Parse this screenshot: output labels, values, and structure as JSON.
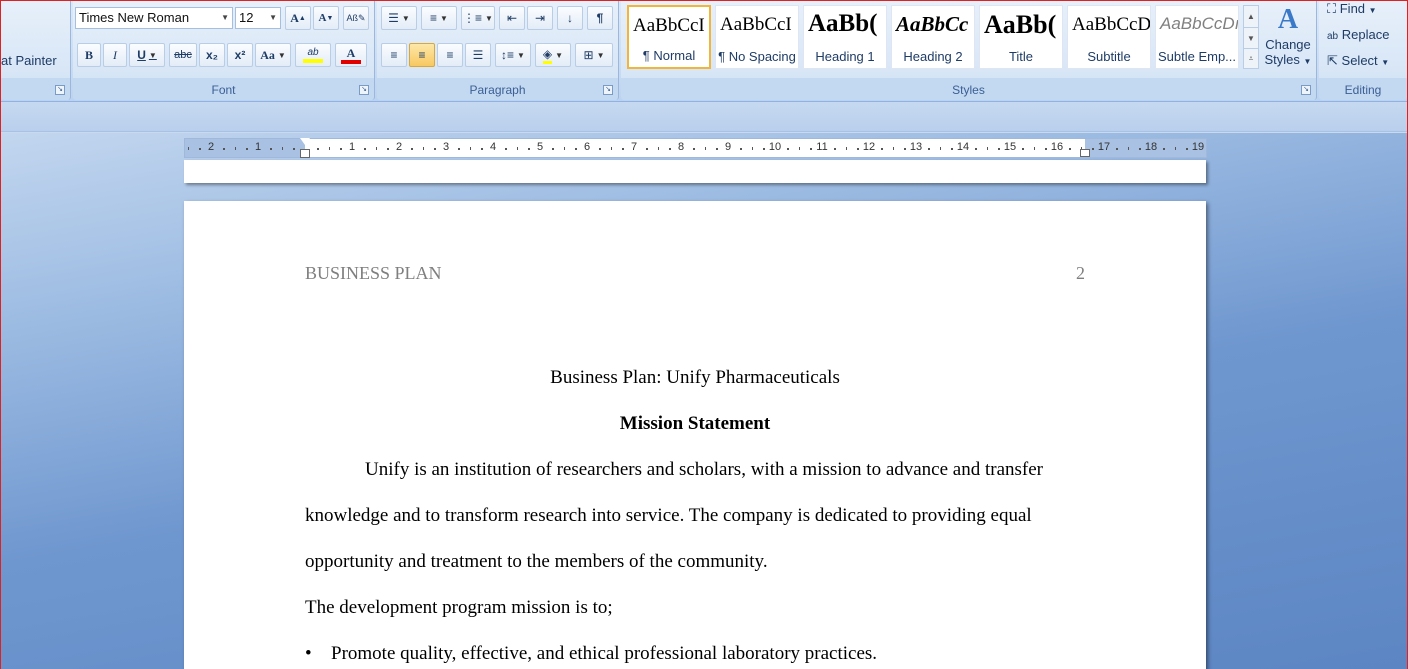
{
  "ribbon": {
    "clipboard": {
      "format_painter_label": "at Painter"
    },
    "font": {
      "group_label": "Font",
      "font_name": "Times New Roman",
      "font_size": "12",
      "grow_label": "A",
      "shrink_label": "A",
      "bold_label": "B",
      "italic_label": "I",
      "underline_label": "U",
      "strike_label": "abc",
      "subscript_label": "x₂",
      "superscript_label": "x²",
      "case_label": "Aa",
      "highlight_label": "ab",
      "font_color_label": "A",
      "highlight_color": "#ffff00",
      "font_color": "#e00000"
    },
    "paragraph": {
      "group_label": "Paragraph",
      "pilcrow": "¶"
    },
    "styles": {
      "group_label": "Styles",
      "tiles": [
        {
          "sample": "AaBbCcI",
          "name": "¶ Normal"
        },
        {
          "sample": "AaBbCcI",
          "name": "¶ No Spacing"
        },
        {
          "sample": "AaBb(",
          "name": "Heading 1"
        },
        {
          "sample": "AaBbCc",
          "name": "Heading 2"
        },
        {
          "sample": "AaBb(",
          "name": "Title"
        },
        {
          "sample": "AaBbCcD",
          "name": "Subtitle"
        },
        {
          "sample": "AaBbCcDı",
          "name": "Subtle Emp..."
        }
      ],
      "change_styles_line1": "Change",
      "change_styles_line2": "Styles"
    },
    "editing": {
      "group_label": "Editing",
      "find_label": "Find",
      "replace_label": "Replace",
      "select_label": "Select"
    }
  },
  "ruler": {
    "left_numbers": [
      "2",
      "1"
    ],
    "right_numbers": [
      "1",
      "2",
      "3",
      "4",
      "5",
      "6",
      "7",
      "8",
      "9",
      "10",
      "11",
      "12",
      "13",
      "14",
      "15",
      "16",
      "17",
      "18",
      "19"
    ]
  },
  "document": {
    "header_left": "BUSINESS PLAN",
    "header_page_number": "2",
    "title": "Business Plan: Unify Pharmaceuticals",
    "heading": "Mission Statement",
    "paragraph_lines": [
      "Unify is an institution of researchers and scholars, with a mission to advance and transfer",
      "knowledge and to transform research into service. The company is dedicated to providing equal",
      "opportunity and treatment to the members of the community."
    ],
    "intro_line": "The development program mission is to;",
    "bullets": [
      "Promote quality, effective, and ethical professional laboratory practices."
    ],
    "bullet_glyph": "•"
  }
}
